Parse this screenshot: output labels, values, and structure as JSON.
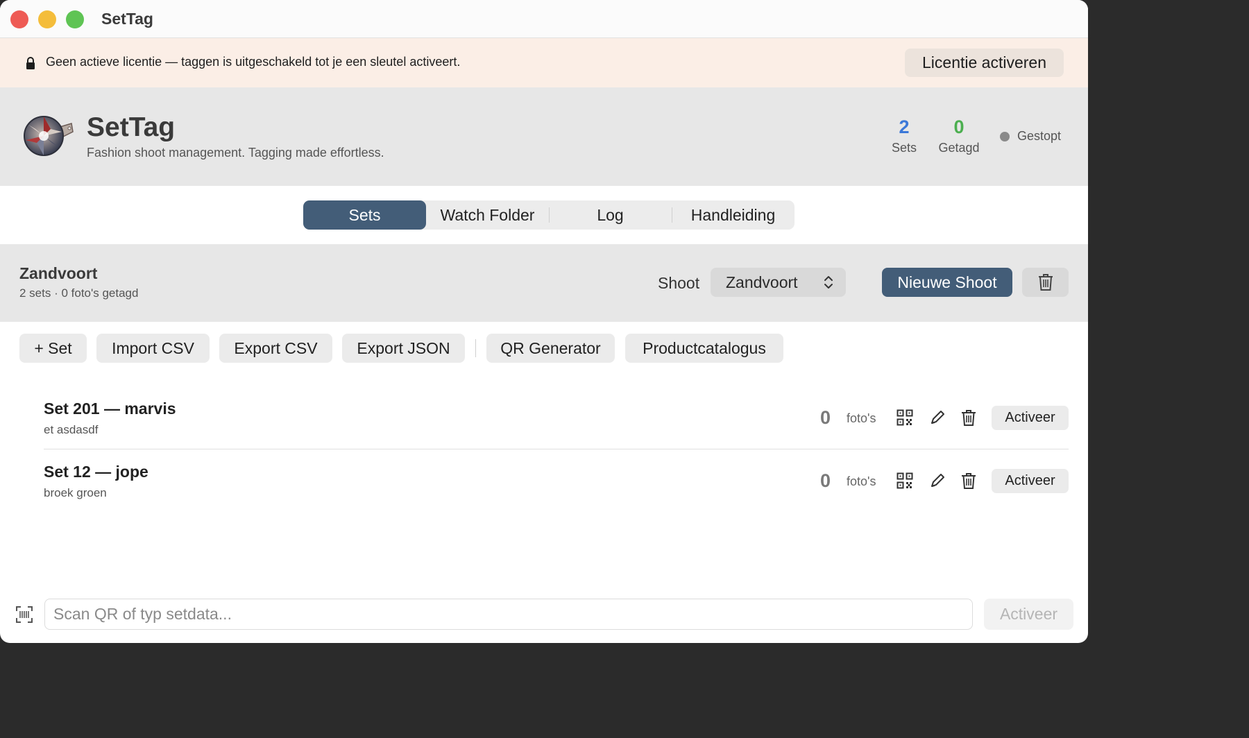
{
  "window": {
    "title": "SetTag"
  },
  "banner": {
    "text": "Geen actieve licentie — taggen is uitgeschakeld tot je een sleutel activeert.",
    "button": "Licentie activeren",
    "icon": "lock-icon"
  },
  "header": {
    "app_name": "SetTag",
    "tagline": "Fashion shoot management. Tagging made effortless.",
    "stats": {
      "sets_value": "2",
      "sets_label": "Sets",
      "tagged_value": "0",
      "tagged_label": "Getagd"
    },
    "status": "Gestopt",
    "colors": {
      "sets": "#3b78d8",
      "tagged": "#4caf50",
      "status_dot": "#8a8a8a"
    }
  },
  "tabs": [
    {
      "label": "Sets",
      "active": true
    },
    {
      "label": "Watch Folder",
      "active": false
    },
    {
      "label": "Log",
      "active": false
    },
    {
      "label": "Handleiding",
      "active": false
    }
  ],
  "shoot": {
    "name": "Zandvoort",
    "meta": "2 sets · 0 foto's getagd",
    "label": "Shoot",
    "selected": "Zandvoort",
    "new_button": "Nieuwe Shoot"
  },
  "toolbar": {
    "add_set": "+ Set",
    "import_csv": "Import CSV",
    "export_csv": "Export CSV",
    "export_json": "Export JSON",
    "qr_generator": "QR Generator",
    "catalog": "Productcatalogus"
  },
  "sets": [
    {
      "title": "Set 201 — marvis",
      "subtitle": "et asdasdf",
      "count": "0",
      "unit": "foto's",
      "action": "Activeer"
    },
    {
      "title": "Set 12 — jope",
      "subtitle": "broek groen",
      "count": "0",
      "unit": "foto's",
      "action": "Activeer"
    }
  ],
  "scan": {
    "placeholder": "Scan QR of typ setdata...",
    "button": "Activeer"
  },
  "accent": "#435d78"
}
